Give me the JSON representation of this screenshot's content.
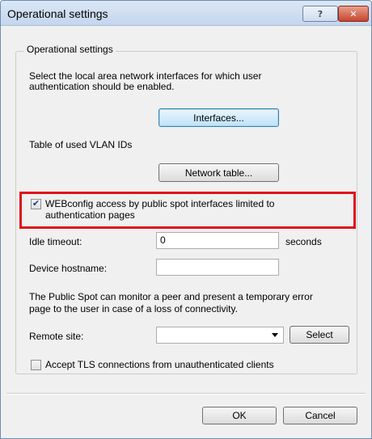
{
  "window": {
    "title": "Operational settings",
    "help_label": "?",
    "close_label": "✕"
  },
  "group": {
    "legend": "Operational settings",
    "description_line1": "Select the local area network interfaces for which user",
    "description_line2": "authentication should be enabled.",
    "interfaces_button": "Interfaces...",
    "vlan_label": "Table of used VLAN IDs",
    "network_table_button": "Network table...",
    "webconfig_checkbox": {
      "checked": true,
      "label_line1": "WEBconfig access by public spot interfaces limited to",
      "label_line2": "authentication pages"
    },
    "idle_timeout": {
      "label": "Idle timeout:",
      "value": "0",
      "unit": "seconds"
    },
    "device_hostname": {
      "label": "Device hostname:",
      "value": ""
    },
    "monitor_text_line1": "The Public Spot can monitor a peer and present a temporary error",
    "monitor_text_line2": "page to the user in case of a loss of connectivity.",
    "remote_site": {
      "label": "Remote site:",
      "value": "",
      "select_button": "Select"
    },
    "tls_checkbox": {
      "checked": false,
      "label": "Accept TLS connections from unauthenticated clients"
    }
  },
  "footer": {
    "ok_label": "OK",
    "cancel_label": "Cancel"
  },
  "colors": {
    "highlight": "#e0101a",
    "window_bg": "#f0f0f0",
    "titlebar": "#c4d6ee"
  }
}
